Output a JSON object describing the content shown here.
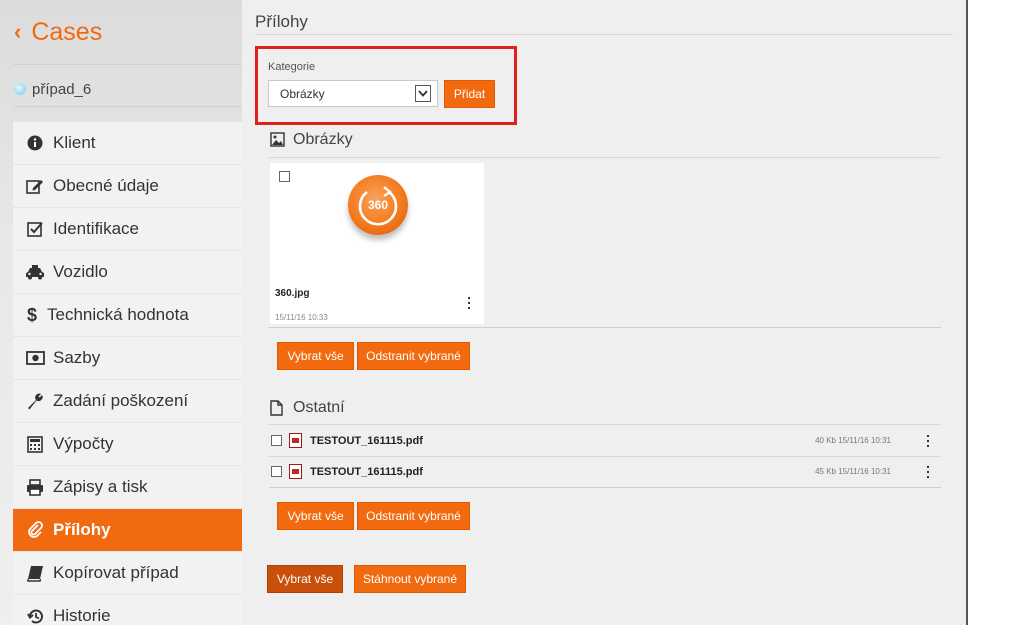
{
  "sidebar": {
    "back_label": "Cases",
    "case_name": "případ_6",
    "items": [
      {
        "label": "Klient",
        "icon": "info-icon",
        "active": false
      },
      {
        "label": "Obecné údaje",
        "icon": "edit-icon",
        "active": false
      },
      {
        "label": "Identifikace",
        "icon": "checkbox-icon",
        "active": false
      },
      {
        "label": "Vozidlo",
        "icon": "taxi-icon",
        "active": false
      },
      {
        "label": "Technická hodnota",
        "icon": "dollar-icon",
        "active": false
      },
      {
        "label": "Sazby",
        "icon": "money-icon",
        "active": false
      },
      {
        "label": "Zadání poškození",
        "icon": "wrench-icon",
        "active": false
      },
      {
        "label": "Výpočty",
        "icon": "calculator-icon",
        "active": false
      },
      {
        "label": "Zápisy a tisk",
        "icon": "print-icon",
        "active": false
      },
      {
        "label": "Přílohy",
        "icon": "paperclip-icon",
        "active": true
      },
      {
        "label": "Kopírovat případ",
        "icon": "book-icon",
        "active": false
      },
      {
        "label": "Historie",
        "icon": "history-icon",
        "active": false
      }
    ]
  },
  "main": {
    "title": "Přílohy",
    "category": {
      "label": "Kategorie",
      "selected": "Obrázky",
      "add_button": "Přidat"
    },
    "images_section": {
      "title": "Obrázky",
      "badge_text": "360",
      "file": {
        "name": "360.jpg",
        "date": "15/11/16 10:33"
      },
      "select_all": "Vybrat vše",
      "remove_selected": "Odstranit vybrané"
    },
    "other_section": {
      "title": "Ostatní",
      "files": [
        {
          "name": "TESTOUT_161115.pdf",
          "meta": "40 Kb 15/11/16 10:31"
        },
        {
          "name": "TESTOUT_161115.pdf",
          "meta": "45 Kb 15/11/16 10:31"
        }
      ],
      "select_all": "Vybrat vše",
      "remove_selected": "Odstranit vybrané"
    },
    "footer": {
      "select_all": "Vybrat vše",
      "download_selected": "Stáhnout vybrané"
    }
  },
  "colors": {
    "accent": "#f26a10",
    "highlight_box": "#e0201f"
  }
}
